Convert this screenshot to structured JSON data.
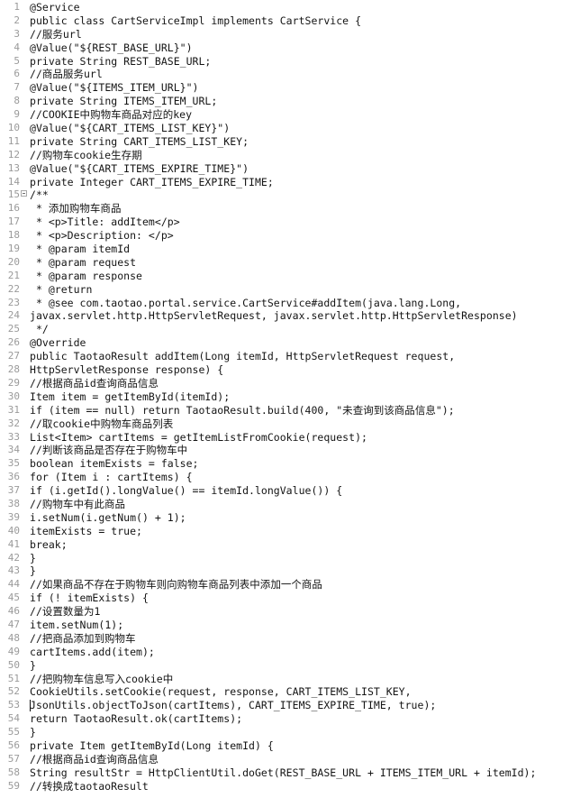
{
  "editor": {
    "language": "java",
    "colors": {
      "background": "#ffffff",
      "text": "#141414",
      "gutter_text": "#9a9a9a",
      "fold_marker_border": "#a8a8a8",
      "caret": "#101010"
    },
    "caret": {
      "line": 53,
      "column": 1
    },
    "fold_markers": [
      15
    ],
    "lines": [
      {
        "n": 1,
        "text": "@Service"
      },
      {
        "n": 2,
        "text": "public class CartServiceImpl implements CartService {"
      },
      {
        "n": 3,
        "text": "//服务url"
      },
      {
        "n": 4,
        "text": "@Value(\"${REST_BASE_URL}\")"
      },
      {
        "n": 5,
        "text": "private String REST_BASE_URL;"
      },
      {
        "n": 6,
        "text": "//商品服务url"
      },
      {
        "n": 7,
        "text": "@Value(\"${ITEMS_ITEM_URL}\")"
      },
      {
        "n": 8,
        "text": "private String ITEMS_ITEM_URL;"
      },
      {
        "n": 9,
        "text": "//COOKIE中购物车商品对应的key"
      },
      {
        "n": 10,
        "text": "@Value(\"${CART_ITEMS_LIST_KEY}\")"
      },
      {
        "n": 11,
        "text": "private String CART_ITEMS_LIST_KEY;"
      },
      {
        "n": 12,
        "text": "//购物车cookie生存期"
      },
      {
        "n": 13,
        "text": "@Value(\"${CART_ITEMS_EXPIRE_TIME}\")"
      },
      {
        "n": 14,
        "text": "private Integer CART_ITEMS_EXPIRE_TIME;"
      },
      {
        "n": 15,
        "text": "/**"
      },
      {
        "n": 16,
        "text": " * 添加购物车商品"
      },
      {
        "n": 17,
        "text": " * <p>Title: addItem</p>"
      },
      {
        "n": 18,
        "text": " * <p>Description: </p>"
      },
      {
        "n": 19,
        "text": " * @param itemId"
      },
      {
        "n": 20,
        "text": " * @param request"
      },
      {
        "n": 21,
        "text": " * @param response"
      },
      {
        "n": 22,
        "text": " * @return"
      },
      {
        "n": 23,
        "text": " * @see com.taotao.portal.service.CartService#addItem(java.lang.Long,"
      },
      {
        "n": 24,
        "text": "javax.servlet.http.HttpServletRequest, javax.servlet.http.HttpServletResponse)"
      },
      {
        "n": 25,
        "text": " */"
      },
      {
        "n": 26,
        "text": "@Override"
      },
      {
        "n": 27,
        "text": "public TaotaoResult addItem(Long itemId, HttpServletRequest request,"
      },
      {
        "n": 28,
        "text": "HttpServletResponse response) {"
      },
      {
        "n": 29,
        "text": "//根据商品id查询商品信息"
      },
      {
        "n": 30,
        "text": "Item item = getItemById(itemId);"
      },
      {
        "n": 31,
        "text": "if (item == null) return TaotaoResult.build(400, \"未查询到该商品信息\");"
      },
      {
        "n": 32,
        "text": "//取cookie中购物车商品列表"
      },
      {
        "n": 33,
        "text": "List<Item> cartItems = getItemListFromCookie(request);"
      },
      {
        "n": 34,
        "text": "//判断该商品是否存在于购物车中"
      },
      {
        "n": 35,
        "text": "boolean itemExists = false;"
      },
      {
        "n": 36,
        "text": "for (Item i : cartItems) {"
      },
      {
        "n": 37,
        "text": "if (i.getId().longValue() == itemId.longValue()) {"
      },
      {
        "n": 38,
        "text": "//购物车中有此商品"
      },
      {
        "n": 39,
        "text": "i.setNum(i.getNum() + 1);"
      },
      {
        "n": 40,
        "text": "itemExists = true;"
      },
      {
        "n": 41,
        "text": "break;"
      },
      {
        "n": 42,
        "text": "}"
      },
      {
        "n": 43,
        "text": "}"
      },
      {
        "n": 44,
        "text": "//如果商品不存在于购物车则向购物车商品列表中添加一个商品"
      },
      {
        "n": 45,
        "text": "if (! itemExists) {"
      },
      {
        "n": 46,
        "text": "//设置数量为1"
      },
      {
        "n": 47,
        "text": "item.setNum(1);"
      },
      {
        "n": 48,
        "text": "//把商品添加到购物车"
      },
      {
        "n": 49,
        "text": "cartItems.add(item);"
      },
      {
        "n": 50,
        "text": "}"
      },
      {
        "n": 51,
        "text": "//把购物车信息写入cookie中"
      },
      {
        "n": 52,
        "text": "CookieUtils.setCookie(request, response, CART_ITEMS_LIST_KEY,"
      },
      {
        "n": 53,
        "text": "JsonUtils.objectToJson(cartItems), CART_ITEMS_EXPIRE_TIME, true);"
      },
      {
        "n": 54,
        "text": "return TaotaoResult.ok(cartItems);"
      },
      {
        "n": 55,
        "text": "}"
      },
      {
        "n": 56,
        "text": "private Item getItemById(Long itemId) {"
      },
      {
        "n": 57,
        "text": "//根据商品id查询商品信息"
      },
      {
        "n": 58,
        "text": "String resultStr = HttpClientUtil.doGet(REST_BASE_URL + ITEMS_ITEM_URL + itemId);"
      },
      {
        "n": 59,
        "text": "//转换成taotaoResult"
      }
    ]
  }
}
